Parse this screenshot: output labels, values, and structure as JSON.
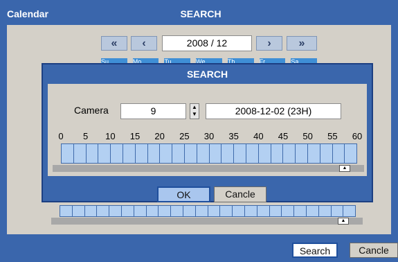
{
  "calendar": {
    "title": "Calendar",
    "header": "SEARCH",
    "month_year": "2008 / 12",
    "nav": {
      "first": "«",
      "prev": "‹",
      "next": "›",
      "last": "»"
    },
    "weekday_tabs": [
      "Su",
      "Mo",
      "Tu",
      "We",
      "Th",
      "Fr",
      "Sa"
    ],
    "search_label": "Search",
    "cancel_label": "Cancle"
  },
  "dialog": {
    "title": "SEARCH",
    "camera_label": "Camera",
    "camera_value": "9",
    "datetime": "2008-12-02 (23H)",
    "minute_ticks": [
      "0",
      "5",
      "10",
      "15",
      "20",
      "25",
      "30",
      "35",
      "40",
      "45",
      "50",
      "55",
      "60"
    ],
    "ok_label": "OK",
    "cancel_label": "Cancle"
  },
  "icons": {
    "spinner": "up-down-arrows",
    "scroll_thumb": "up-arrow"
  },
  "colors": {
    "frame": "#3a66ac",
    "panel": "#d4d0c8",
    "timeline_cell": "#b3d0f2",
    "border_blue": "#3f6aaa"
  }
}
